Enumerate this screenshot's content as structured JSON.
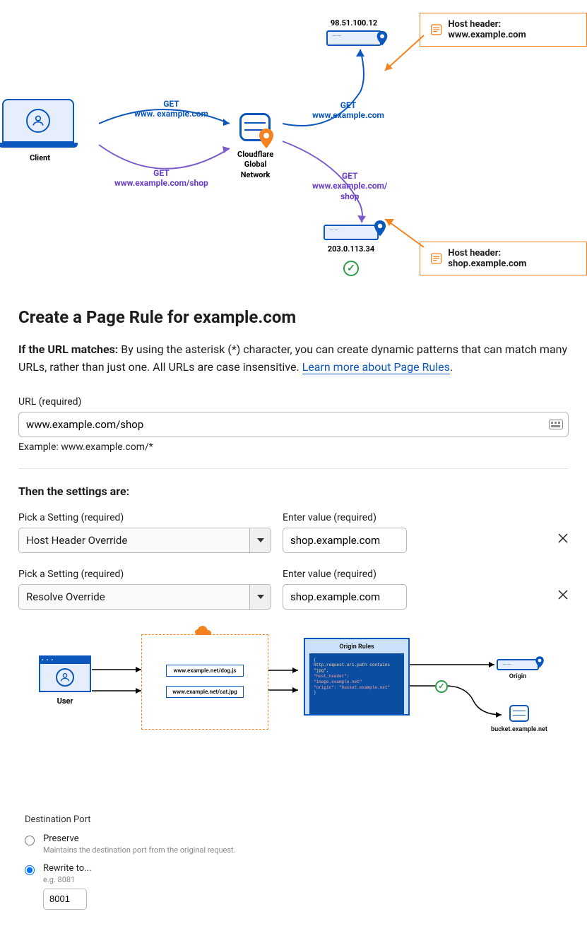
{
  "diagram1": {
    "client_label": "Client",
    "req1_method": "GET",
    "req1_host": "www. example.com",
    "req2_method": "GET",
    "req2_host": "www.example.com/shop",
    "cf_label1": "Cloudflare",
    "cf_label2": "Global",
    "cf_label3": "Network",
    "req3_method": "GET",
    "req3_host": "www.example.com",
    "req4_method": "GET",
    "req4_host": "www.example.com/",
    "req4_path": "shop",
    "server1_ip": "98.51.100.12",
    "server2_ip": "203.0.113.34",
    "callout1": "Host header: www.example.com",
    "callout2": "Host header: shop.example.com"
  },
  "page": {
    "title": "Create a Page Rule for example.com",
    "intro_bold": "If the URL matches:",
    "intro_text": " By using the asterisk (*) character, you can create dynamic patterns that can match many URLs, rather than just one. All URLs are case insensitive. ",
    "intro_link": "Learn more about Page Rules",
    "url_label": "URL (required)",
    "url_value": "www.example.com/shop",
    "url_hint": "Example: www.example.com/*",
    "then_heading": "Then the settings are:",
    "setting_label": "Pick a Setting (required)",
    "value_label": "Enter value (required)",
    "settings": [
      {
        "setting": "Host Header Override",
        "value": "shop.example.com"
      },
      {
        "setting": "Resolve Override",
        "value": "shop.example.com"
      }
    ]
  },
  "diagram2": {
    "user_label": "User",
    "url1": "www.example.net/dog.js",
    "url2": "www.example.net/cat.jpg",
    "rules_title": "Origin Rules",
    "code_line1": "http.request.uri.path contains \"jpg\"",
    "code_line2": "\"host_header\": \"image.example.net\"",
    "code_line3": "\"origin\": \"bucket.example.net\"",
    "origin_label": "Origin",
    "bucket_label": "bucket.example.net"
  },
  "dest_port": {
    "title": "Destination Port",
    "preserve_label": "Preserve",
    "preserve_desc": "Maintains the destination port from the original request.",
    "rewrite_label": "Rewrite to...",
    "rewrite_desc": "e.g. 8081",
    "rewrite_value": "8001"
  }
}
